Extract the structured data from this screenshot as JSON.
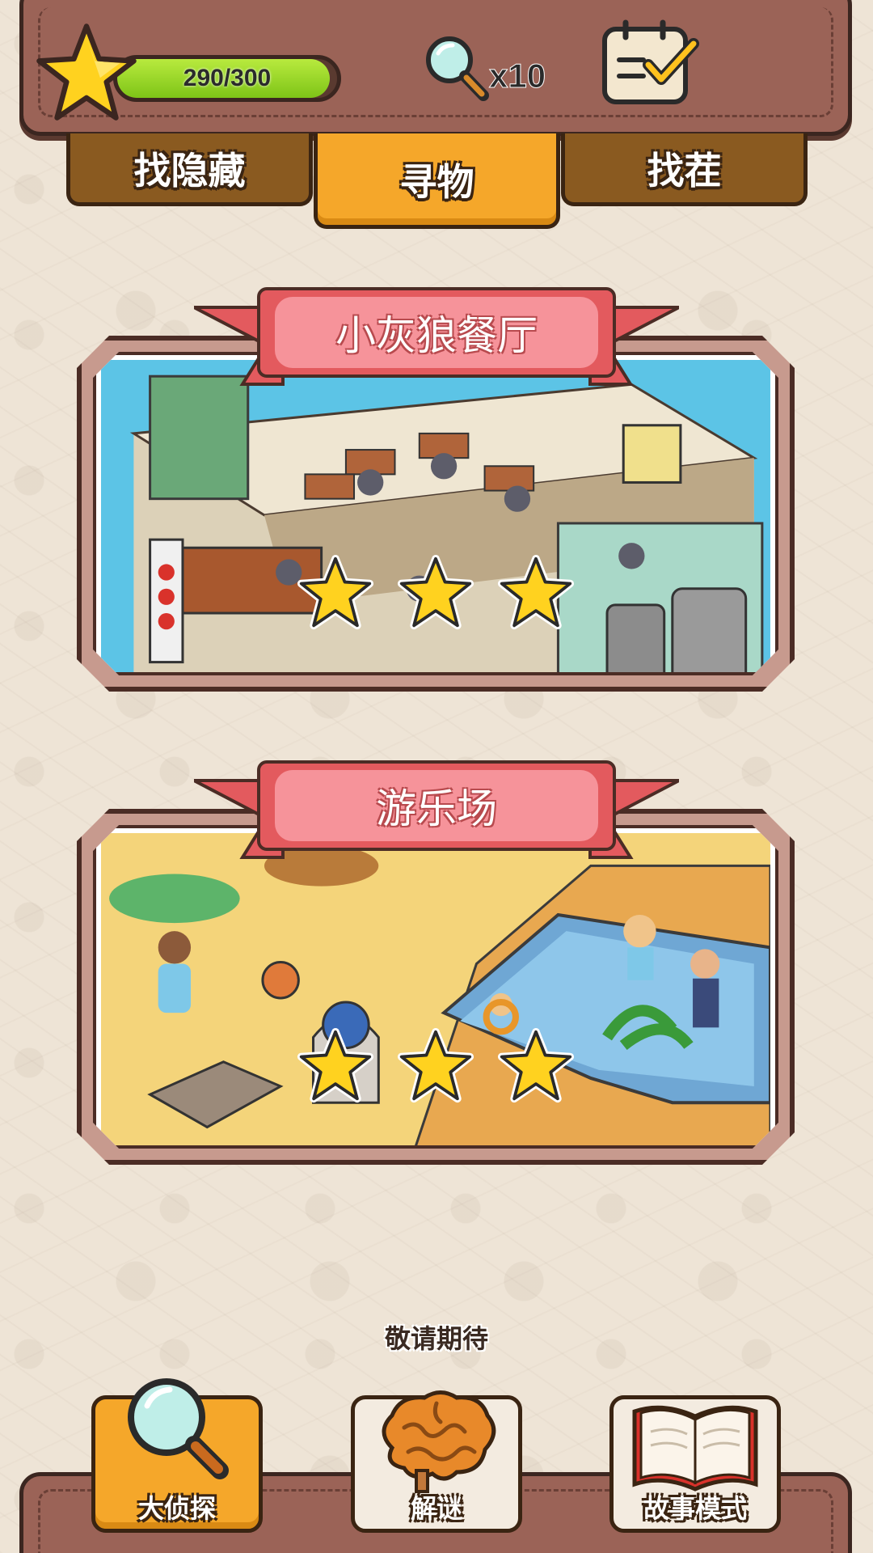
{
  "header": {
    "xp_text": "290/300",
    "xp_progress": 0.9667,
    "magnifier_count": "x10"
  },
  "tabs": [
    {
      "label": "找隐藏",
      "active": false
    },
    {
      "label": "寻物",
      "active": true
    },
    {
      "label": "找茬",
      "active": false
    }
  ],
  "levels": [
    {
      "title": "小灰狼餐厅",
      "stars": 3
    },
    {
      "title": "游乐场",
      "stars": 3
    }
  ],
  "coming_soon": "敬请期待",
  "bottom_nav": [
    {
      "label": "大侦探",
      "icon": "magnifier-icon",
      "active": true
    },
    {
      "label": "解谜",
      "icon": "brain-icon",
      "active": false
    },
    {
      "label": "故事模式",
      "icon": "book-icon",
      "active": false
    }
  ],
  "colors": {
    "accent_orange": "#f5a72a",
    "tab_brown": "#8a5a20",
    "header_brown": "#9b6357",
    "ribbon_pink": "#f08a8c",
    "star_yellow": "#ffd21f",
    "xp_green": "#8fd22a"
  }
}
